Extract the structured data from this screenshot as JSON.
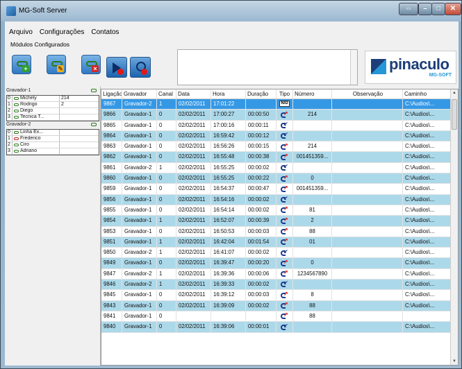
{
  "window": {
    "title": "MG-Soft Server"
  },
  "menu": [
    "Arquivo",
    "Configurações",
    "Contatos"
  ],
  "modules": {
    "label": "Módulos Configurados"
  },
  "gravadores": [
    {
      "name": "Gravador-1",
      "channels": [
        {
          "idx": "0",
          "name": "Michely",
          "ext": "214",
          "color": "green"
        },
        {
          "idx": "1",
          "name": "Rodrigo",
          "ext": "2",
          "color": "green"
        },
        {
          "idx": "2",
          "name": "Diego",
          "ext": "",
          "color": "green"
        },
        {
          "idx": "3",
          "name": "Tecnica T...",
          "ext": "",
          "color": "green"
        }
      ]
    },
    {
      "name": "Gravador-2",
      "channels": [
        {
          "idx": "0",
          "name": "Linha Ex...",
          "ext": "",
          "color": "green"
        },
        {
          "idx": "1",
          "name": "Frederico",
          "ext": "",
          "color": "red"
        },
        {
          "idx": "2",
          "name": "Ciro",
          "ext": "",
          "color": "green"
        },
        {
          "idx": "3",
          "name": "Adriano",
          "ext": "",
          "color": "green"
        }
      ]
    }
  ],
  "logo": {
    "text": "pinaculo",
    "sub": "MG-SOFT"
  },
  "grid": {
    "headers": [
      "Ligação",
      "Gravador",
      "Canal",
      "Data",
      "Hora",
      "Duração",
      "Tipo",
      "Número",
      "Observação",
      "Caminho"
    ],
    "rows": [
      {
        "lig": "9867",
        "grav": "Gravador-2",
        "can": "1",
        "data": "02/02/2011",
        "hora": "17:01:22",
        "dur": "",
        "tipo": "nd",
        "num": "",
        "obs": "",
        "cam": "C:\\Audios\\..."
      },
      {
        "lig": "9866",
        "grav": "Gravador-1",
        "can": "0",
        "data": "02/02/2011",
        "hora": "17:00:27",
        "dur": "00:00:50",
        "tipo": "out",
        "num": "214",
        "obs": "",
        "cam": "C:\\Audios\\..."
      },
      {
        "lig": "9865",
        "grav": "Gravador-1",
        "can": "0",
        "data": "02/02/2011",
        "hora": "17:00:16",
        "dur": "00:00:11",
        "tipo": "in",
        "num": "",
        "obs": "",
        "cam": "C:\\Audios\\..."
      },
      {
        "lig": "9864",
        "grav": "Gravador-1",
        "can": "0",
        "data": "02/02/2011",
        "hora": "16:59:42",
        "dur": "00:00:12",
        "tipo": "in",
        "num": "",
        "obs": "",
        "cam": "C:\\Audios\\..."
      },
      {
        "lig": "9863",
        "grav": "Gravador-1",
        "can": "0",
        "data": "02/02/2011",
        "hora": "16:56:26",
        "dur": "00:00:15",
        "tipo": "out",
        "num": "214",
        "obs": "",
        "cam": "C:\\Audios\\..."
      },
      {
        "lig": "9862",
        "grav": "Gravador-1",
        "can": "0",
        "data": "02/02/2011",
        "hora": "16:55:48",
        "dur": "00:00:38",
        "tipo": "out",
        "num": "001451359...",
        "obs": "",
        "cam": "C:\\Audios\\..."
      },
      {
        "lig": "9861",
        "grav": "Gravador-2",
        "can": "1",
        "data": "02/02/2011",
        "hora": "16:55:25",
        "dur": "00:00:02",
        "tipo": "in",
        "num": "",
        "obs": "",
        "cam": "C:\\Audios\\..."
      },
      {
        "lig": "9860",
        "grav": "Gravador-1",
        "can": "0",
        "data": "02/02/2011",
        "hora": "16:55:25",
        "dur": "00:00:22",
        "tipo": "out",
        "num": "0",
        "obs": "",
        "cam": "C:\\Audios\\..."
      },
      {
        "lig": "9859",
        "grav": "Gravador-1",
        "can": "0",
        "data": "02/02/2011",
        "hora": "16:54:37",
        "dur": "00:00:47",
        "tipo": "out",
        "num": "001451359...",
        "obs": "",
        "cam": "C:\\Audios\\..."
      },
      {
        "lig": "9856",
        "grav": "Gravador-1",
        "can": "0",
        "data": "02/02/2011",
        "hora": "16:54:16",
        "dur": "00:00:02",
        "tipo": "in",
        "num": "",
        "obs": "",
        "cam": "C:\\Audios\\..."
      },
      {
        "lig": "9855",
        "grav": "Gravador-1",
        "can": "0",
        "data": "02/02/2011",
        "hora": "16:54:14",
        "dur": "00:00:02",
        "tipo": "out",
        "num": "81",
        "obs": "",
        "cam": "C:\\Audios\\..."
      },
      {
        "lig": "9854",
        "grav": "Gravador-1",
        "can": "1",
        "data": "02/02/2011",
        "hora": "16:52:07",
        "dur": "00:00:39",
        "tipo": "out",
        "num": "2",
        "obs": "",
        "cam": "C:\\Audios\\..."
      },
      {
        "lig": "9853",
        "grav": "Gravador-1",
        "can": "0",
        "data": "02/02/2011",
        "hora": "16:50:53",
        "dur": "00:00:03",
        "tipo": "out",
        "num": "88",
        "obs": "",
        "cam": "C:\\Audios\\..."
      },
      {
        "lig": "9851",
        "grav": "Gravador-1",
        "can": "1",
        "data": "02/02/2011",
        "hora": "16:42:04",
        "dur": "00:01:54",
        "tipo": "out",
        "num": "01",
        "obs": "",
        "cam": "C:\\Audios\\..."
      },
      {
        "lig": "9850",
        "grav": "Gravador-2",
        "can": "1",
        "data": "02/02/2011",
        "hora": "16:41:07",
        "dur": "00:00:02",
        "tipo": "in",
        "num": "",
        "obs": "",
        "cam": "C:\\Audios\\..."
      },
      {
        "lig": "9849",
        "grav": "Gravador-1",
        "can": "0",
        "data": "02/02/2011",
        "hora": "16:39:47",
        "dur": "00:00:20",
        "tipo": "out",
        "num": "0",
        "obs": "",
        "cam": "C:\\Audios\\..."
      },
      {
        "lig": "9847",
        "grav": "Gravador-2",
        "can": "1",
        "data": "02/02/2011",
        "hora": "16:39:36",
        "dur": "00:00:06",
        "tipo": "out",
        "num": "1234567890",
        "obs": "",
        "cam": "C:\\Audios\\..."
      },
      {
        "lig": "9846",
        "grav": "Gravador-2",
        "can": "1",
        "data": "02/02/2011",
        "hora": "16:39:33",
        "dur": "00:00:02",
        "tipo": "in",
        "num": "",
        "obs": "",
        "cam": "C:\\Audios\\..."
      },
      {
        "lig": "9845",
        "grav": "Gravador-1",
        "can": "0",
        "data": "02/02/2011",
        "hora": "16:39:12",
        "dur": "00:00:03",
        "tipo": "out",
        "num": "8",
        "obs": "",
        "cam": "C:\\Audios\\..."
      },
      {
        "lig": "9843",
        "grav": "Gravador-1",
        "can": "0",
        "data": "02/02/2011",
        "hora": "16:39:09",
        "dur": "00:00:02",
        "tipo": "out",
        "num": "88",
        "obs": "",
        "cam": "C:\\Audios\\..."
      },
      {
        "lig": "9841",
        "grav": "Gravador-1",
        "can": "0",
        "data": "",
        "hora": "",
        "dur": "",
        "tipo": "out",
        "num": "88",
        "obs": "",
        "cam": ""
      },
      {
        "lig": "9840",
        "grav": "Gravador-1",
        "can": "0",
        "data": "02/02/2011",
        "hora": "16:39:06",
        "dur": "00:00:01",
        "tipo": "in",
        "num": "",
        "obs": "",
        "cam": "C:\\Audios\\..."
      }
    ]
  }
}
